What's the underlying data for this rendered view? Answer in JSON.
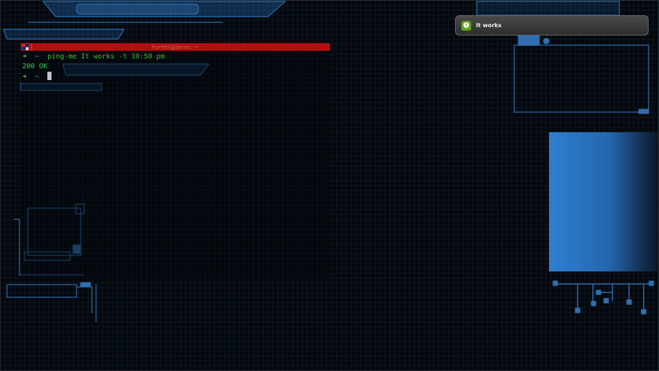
{
  "desktop": {
    "name": "hud-grid-wallpaper"
  },
  "terminal": {
    "title": "hunter@jarvis: ~",
    "lines": [
      {
        "prompt_arrow": "➜",
        "prompt_dir": "~",
        "command": "ping-me It works -t 10:50 pm"
      },
      {
        "output": "200 OK"
      },
      {
        "prompt_arrow": "➜",
        "prompt_dir": "~",
        "command": ""
      }
    ]
  },
  "notification": {
    "icon": "info-icon",
    "icon_glyph": "i",
    "message": "It works"
  },
  "colors": {
    "terminal_titlebar": "#b30f0f",
    "prompt_arrow": "#7bd93a",
    "command_text": "#3ec12e",
    "notification_icon": "#5fa71f"
  }
}
